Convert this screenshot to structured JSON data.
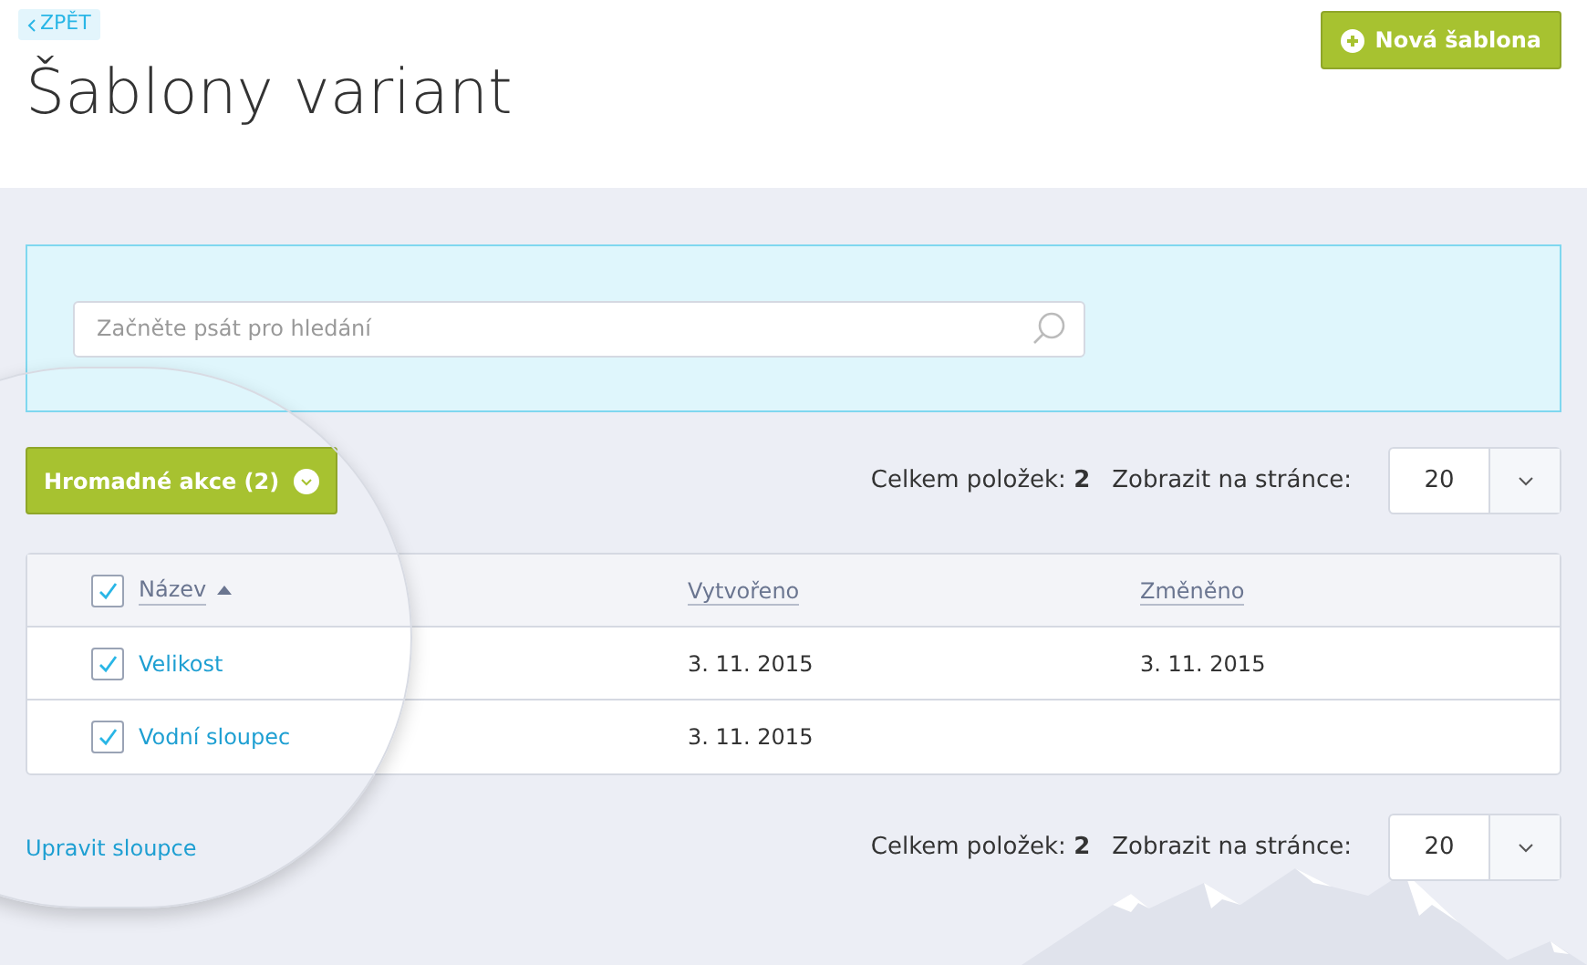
{
  "back_link": "ZPĚT",
  "title": "Šablony variant",
  "new_button": "Nová šablona",
  "search": {
    "placeholder": "Začněte psát pro hledání"
  },
  "bulk_button": "Hromadné akce (2)",
  "pagination_top": {
    "total_label": "Celkem položek:",
    "total": "2",
    "per_page_label": "Zobrazit na stránce:",
    "per_page": "20"
  },
  "table": {
    "select_all": {
      "checked": true
    },
    "columns": [
      {
        "label": "Název",
        "sorted": true
      },
      {
        "label": "Vytvořeno",
        "sorted": false
      },
      {
        "label": "Změněno",
        "sorted": false
      }
    ],
    "rows": [
      {
        "checked": true,
        "name": "Velikost",
        "created": "3. 11. 2015",
        "modified": "3. 11. 2015"
      },
      {
        "checked": true,
        "name": "Vodní sloupec",
        "created": "3. 11. 2015"
      }
    ]
  },
  "edit_columns_link": "Upravit sloupce",
  "pagination_bottom": {
    "total_label": "Celkem položek:",
    "total": "2",
    "per_page_label": "Zobrazit na stránce:",
    "per_page": "20"
  }
}
